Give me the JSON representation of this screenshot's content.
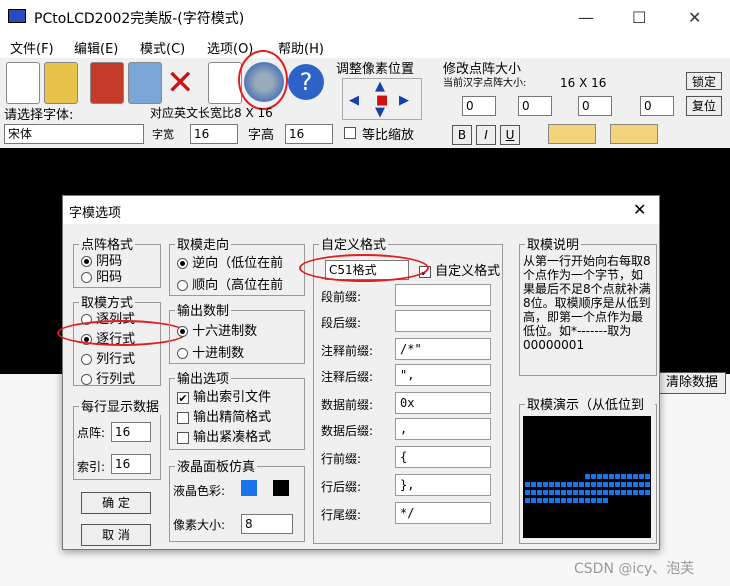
{
  "window": {
    "title": "PCtoLCD2002完美版-(字符模式)",
    "min": "—",
    "max": "☐",
    "close": "✕"
  },
  "menu": [
    "文件(F)",
    "编辑(E)",
    "模式(C)",
    "选项(O)",
    "帮助(H)"
  ],
  "toolbar": {
    "adjust_label": "调整像素位置",
    "dot_size_label": "修改点阵大小",
    "hz_size_label": "当前汉字点阵大小:",
    "hz_size_value": "16 X 16",
    "lock_btn": "锁定",
    "reset_btn": "复位",
    "spins": [
      "0",
      "0",
      "0",
      "0"
    ],
    "font_select_label": "请选择字体:",
    "font_value": "宋体",
    "ratio_label": "对应英文长宽比8 X 16",
    "width_label": "字宽",
    "width_value": "16",
    "height_label": "字高",
    "height_value": "16",
    "equal_scale": "等比缩放",
    "bold": "B",
    "italic": "I",
    "underline": "U"
  },
  "clear_btn": "清除数据",
  "dialog": {
    "title": "字模选项",
    "close": "✕",
    "dot_format": {
      "label": "点阵格式",
      "options": [
        "阴码",
        "阳码"
      ],
      "selected": 0
    },
    "scan_mode": {
      "label": "取模方式",
      "options": [
        "逐列式",
        "逐行式",
        "列行式",
        "行列式"
      ],
      "selected": 1
    },
    "per_line": {
      "label": "每行显示数据",
      "dot_label": "点阵:",
      "dot_value": "16",
      "index_label": "索引:",
      "index_value": "16"
    },
    "direction": {
      "label": "取模走向",
      "options": [
        "逆向（低位在前",
        "顺向（高位在前"
      ],
      "selected": 0
    },
    "radix": {
      "label": "输出数制",
      "options": [
        "十六进制数",
        "十进制数"
      ],
      "selected": 0
    },
    "output_opts": {
      "label": "输出选项",
      "options": [
        "输出索引文件",
        "输出精简格式",
        "输出紧凑格式"
      ],
      "checked": [
        true,
        false,
        false
      ]
    },
    "lcd_sim": {
      "label": "液晶面板仿真",
      "color_label": "液晶色彩:",
      "pixel_label": "像素大小:",
      "pixel_value": "8",
      "fg": "#1a73e8",
      "bg": "#000000"
    },
    "custom": {
      "label": "自定义格式",
      "format_value": "C51格式",
      "custom_check": "自定义格式",
      "rows": [
        {
          "label": "段前缀:",
          "value": ""
        },
        {
          "label": "段后缀:",
          "value": ""
        },
        {
          "label": "注释前缀:",
          "value": "/*\""
        },
        {
          "label": "注释后缀:",
          "value": "\","
        },
        {
          "label": "数据前缀:",
          "value": "0x"
        },
        {
          "label": "数据后缀:",
          "value": ","
        },
        {
          "label": "行前缀:",
          "value": "{"
        },
        {
          "label": "行后缀:",
          "value": "},"
        },
        {
          "label": "行尾缀:",
          "value": "*/"
        }
      ]
    },
    "desc": {
      "label": "取模说明",
      "text": "从第一行开始向右每取8个点作为一个字节，如果最后不足8个点就补满8位。取模顺序是从低到高，即第一个点作为最低位。如*-------取为00000001"
    },
    "demo": {
      "label": "取模演示（从低位到"
    },
    "ok": "确 定",
    "cancel": "取 消"
  },
  "watermark": "CSDN @icy、泡芙"
}
